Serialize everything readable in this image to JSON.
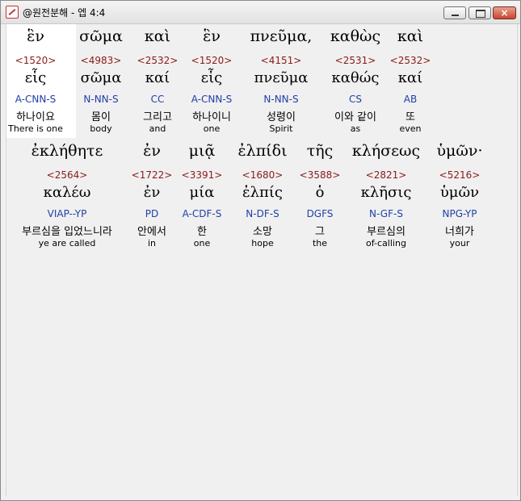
{
  "window": {
    "title": "@원전분해 - 엡 4:4"
  },
  "controls": {
    "minimize": "",
    "maximize": "",
    "close": "×"
  },
  "rows": [
    {
      "words": [
        {
          "greek": "ἓν",
          "strong": "<1520>",
          "lemma": "εἷς",
          "parse": "A-CNN-S",
          "korean": "하나이요",
          "english": "There is one"
        },
        {
          "greek": "σῶμα",
          "strong": "<4983>",
          "lemma": "σῶμα",
          "parse": "N-NN-S",
          "korean": "몸이",
          "english": "body"
        },
        {
          "greek": "καὶ",
          "strong": "<2532>",
          "lemma": "καί",
          "parse": "CC",
          "korean": "그리고",
          "english": "and"
        },
        {
          "greek": "ἓν",
          "strong": "<1520>",
          "lemma": "εἷς",
          "parse": "A-CNN-S",
          "korean": "하나이니",
          "english": "one"
        },
        {
          "greek": "πνεῦμα,",
          "strong": "<4151>",
          "lemma": "πνεῦμα",
          "parse": "N-NN-S",
          "korean": "성령이",
          "english": "Spirit"
        },
        {
          "greek": "καθὼς",
          "strong": "<2531>",
          "lemma": "καθώς",
          "parse": "CS",
          "korean": "이와 같이",
          "english": "as"
        },
        {
          "greek": "καὶ",
          "strong": "<2532>",
          "lemma": "καί",
          "parse": "AB",
          "korean": "또",
          "english": "even"
        }
      ]
    },
    {
      "words": [
        {
          "greek": "ἐκλήθητε",
          "strong": "<2564>",
          "lemma": "καλέω",
          "parse": "VIAP--YP",
          "korean": "부르심을 입었느니라",
          "english": "ye are called"
        },
        {
          "greek": "ἐν",
          "strong": "<1722>",
          "lemma": "ἐν",
          "parse": "PD",
          "korean": "안에서",
          "english": "in"
        },
        {
          "greek": "μιᾷ",
          "strong": "<3391>",
          "lemma": "μία",
          "parse": "A-CDF-S",
          "korean": "한",
          "english": "one"
        },
        {
          "greek": "ἐλπίδι",
          "strong": "<1680>",
          "lemma": "ἐλπίς",
          "parse": "N-DF-S",
          "korean": "소망",
          "english": "hope"
        },
        {
          "greek": "τῆς",
          "strong": "<3588>",
          "lemma": "ὁ",
          "parse": "DGFS",
          "korean": "그",
          "english": "the"
        },
        {
          "greek": "κλήσεως",
          "strong": "<2821>",
          "lemma": "κλῆσις",
          "parse": "N-GF-S",
          "korean": "부르심의",
          "english": "of-calling"
        },
        {
          "greek": "ὑμῶν·",
          "strong": "<5216>",
          "lemma": "ὑμῶν",
          "parse": "NPG-YP",
          "korean": "너희가",
          "english": "your"
        }
      ]
    }
  ]
}
